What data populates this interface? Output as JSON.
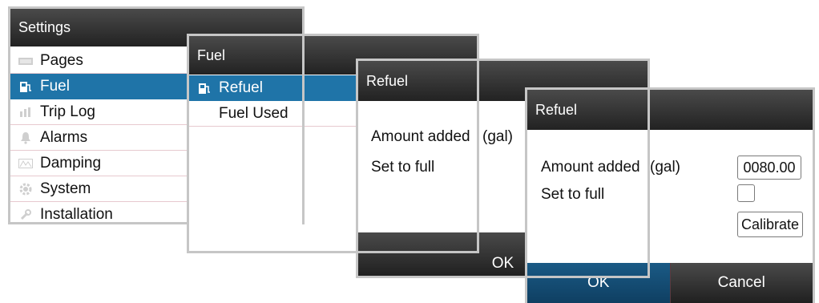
{
  "settings": {
    "title": "Settings",
    "items": [
      {
        "label": "Pages",
        "icon": "pages-icon"
      },
      {
        "label": "Fuel",
        "icon": "fuel-pump-icon"
      },
      {
        "label": "Trip Log",
        "icon": "trip-log-icon"
      },
      {
        "label": "Alarms",
        "icon": "bell-icon"
      },
      {
        "label": "Damping",
        "icon": "damping-icon"
      },
      {
        "label": "System",
        "icon": "gear-icon"
      },
      {
        "label": "Installation",
        "icon": "wrench-icon"
      }
    ],
    "selected": "Fuel"
  },
  "fuel": {
    "title": "Fuel",
    "items": [
      {
        "label": "Refuel",
        "icon": "fuel-pump-icon"
      },
      {
        "label": "Fuel Used"
      }
    ],
    "selected": "Refuel"
  },
  "refuel_back": {
    "title": "Refuel",
    "amount_label": "Amount added",
    "unit": "(gal)",
    "set_full_label": "Set to full",
    "ok_label": "OK"
  },
  "refuel_front": {
    "title": "Refuel",
    "amount_label": "Amount added",
    "unit": "(gal)",
    "amount_value": "0080.00",
    "set_full_label": "Set to full",
    "set_full_checked": false,
    "calibrate_label": "Calibrate",
    "ok_label": "OK",
    "cancel_label": "Cancel"
  },
  "colors": {
    "accent": "#1f74a8",
    "titlebar": "#333333",
    "frame": "#c6c6c6"
  }
}
